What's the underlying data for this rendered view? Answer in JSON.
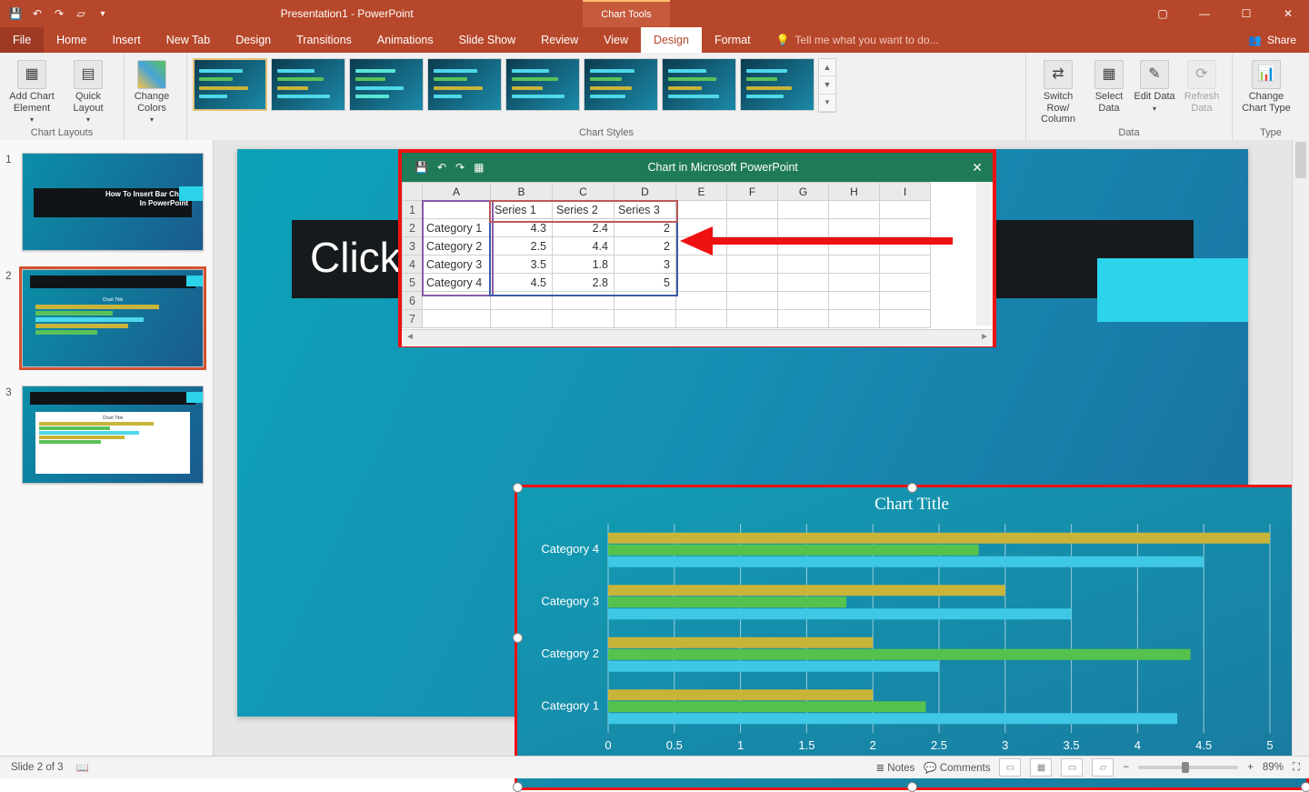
{
  "titlebar": {
    "doc_title": "Presentation1 - PowerPoint",
    "context_tab": "Chart Tools"
  },
  "ribbon_tabs": {
    "file": "File",
    "items": [
      "Home",
      "Insert",
      "New Tab",
      "Design",
      "Transitions",
      "Animations",
      "Slide Show",
      "Review",
      "View",
      "Design",
      "Format"
    ],
    "active_index": 9,
    "tell_me": "Tell me what you want to do...",
    "share": "Share"
  },
  "ribbon": {
    "layouts": {
      "add_element": "Add Chart Element",
      "quick_layout": "Quick Layout",
      "group": "Chart Layouts"
    },
    "colors": {
      "change_colors": "Change Colors"
    },
    "styles_group": "Chart Styles",
    "data": {
      "switch": "Switch Row/ Column",
      "select": "Select Data",
      "edit": "Edit Data",
      "refresh": "Refresh Data",
      "group": "Data"
    },
    "type": {
      "change": "Change Chart Type",
      "group": "Type"
    }
  },
  "thumbs": {
    "slide1_line1": "How To Insert Bar Chart",
    "slide1_line2": "In PowerPoint"
  },
  "slide": {
    "title_placeholder": "Click"
  },
  "sheet": {
    "title": "Chart in Microsoft PowerPoint",
    "col_letters": [
      "A",
      "B",
      "C",
      "D",
      "E",
      "F",
      "G",
      "H",
      "I"
    ],
    "headers": [
      "",
      "Series 1",
      "Series 2",
      "Series 3"
    ],
    "rows": [
      {
        "n": "1"
      },
      {
        "n": "2",
        "cat": "Category 1",
        "vals": [
          "4.3",
          "2.4",
          "2"
        ]
      },
      {
        "n": "3",
        "cat": "Category 2",
        "vals": [
          "2.5",
          "4.4",
          "2"
        ]
      },
      {
        "n": "4",
        "cat": "Category 3",
        "vals": [
          "3.5",
          "1.8",
          "3"
        ]
      },
      {
        "n": "5",
        "cat": "Category 4",
        "vals": [
          "4.5",
          "2.8",
          "5"
        ]
      },
      {
        "n": "6"
      },
      {
        "n": "7"
      }
    ]
  },
  "chart_data": {
    "type": "bar",
    "orientation": "horizontal",
    "title": "Chart Title",
    "categories": [
      "Category 1",
      "Category 2",
      "Category 3",
      "Category 4"
    ],
    "series": [
      {
        "name": "Series 1",
        "values": [
          4.3,
          2.5,
          3.5,
          4.5
        ],
        "color": "#3ec8e6"
      },
      {
        "name": "Series 2",
        "values": [
          2.4,
          4.4,
          1.8,
          2.8
        ],
        "color": "#55c24e"
      },
      {
        "name": "Series 3",
        "values": [
          2,
          2,
          3,
          5
        ],
        "color": "#c9b43a"
      }
    ],
    "xlim": [
      0,
      5
    ],
    "xticks": [
      0,
      0.5,
      1,
      1.5,
      2,
      2.5,
      3,
      3.5,
      4,
      4.5,
      5
    ],
    "legend_order": [
      "Series 3",
      "Series 2",
      "Series 1"
    ],
    "category_draw_order": [
      "Category 4",
      "Category 3",
      "Category 2",
      "Category 1"
    ]
  },
  "side_buttons": {
    "plus": "+",
    "brush": "brush",
    "funnel": "funnel"
  },
  "status": {
    "slide": "Slide 2 of 3",
    "notes": "Notes",
    "comments": "Comments",
    "zoom": "89%"
  }
}
